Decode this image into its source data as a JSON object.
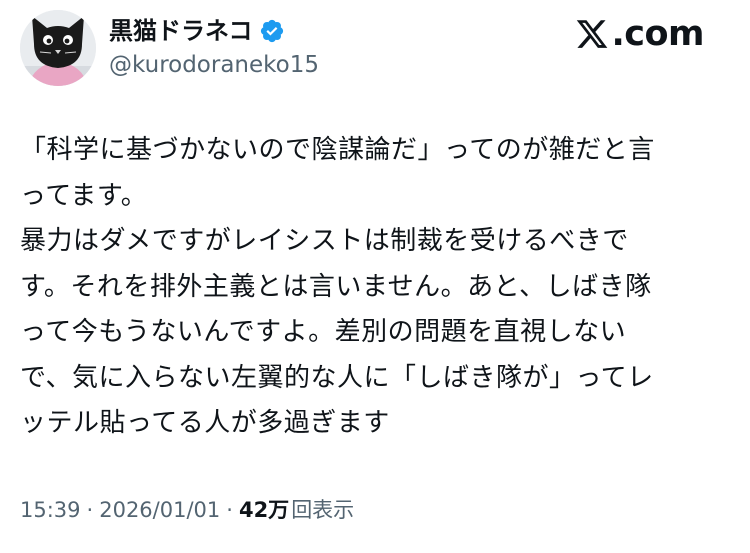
{
  "author": {
    "display_name": "黒猫ドラネコ",
    "handle": "@kurodoraneko15",
    "verified": true
  },
  "brand": {
    "text": ".com",
    "icon": "x-logo-icon"
  },
  "tweet": {
    "lines": [
      "「科学に基づかないので陰謀論だ」ってのが雑だと言",
      "ってます。",
      "暴力はダメですがレイシストは制裁を受けるべきで",
      "す。それを排外主義とは言いません。あと、しばき隊",
      "って今もうないんですよ。差別の問題を直視しない",
      "で、気に入らない左翼的な人に「しばき隊が」ってレ",
      "ッテル貼ってる人が多過ぎます"
    ]
  },
  "meta": {
    "time": "15:39",
    "separator": "·",
    "date": "2026/01/01",
    "views_count": "42万",
    "views_label": "回表示"
  },
  "colors": {
    "text": "#0f1419",
    "secondary": "#536471",
    "verified_badge": "#1d9bf0"
  }
}
